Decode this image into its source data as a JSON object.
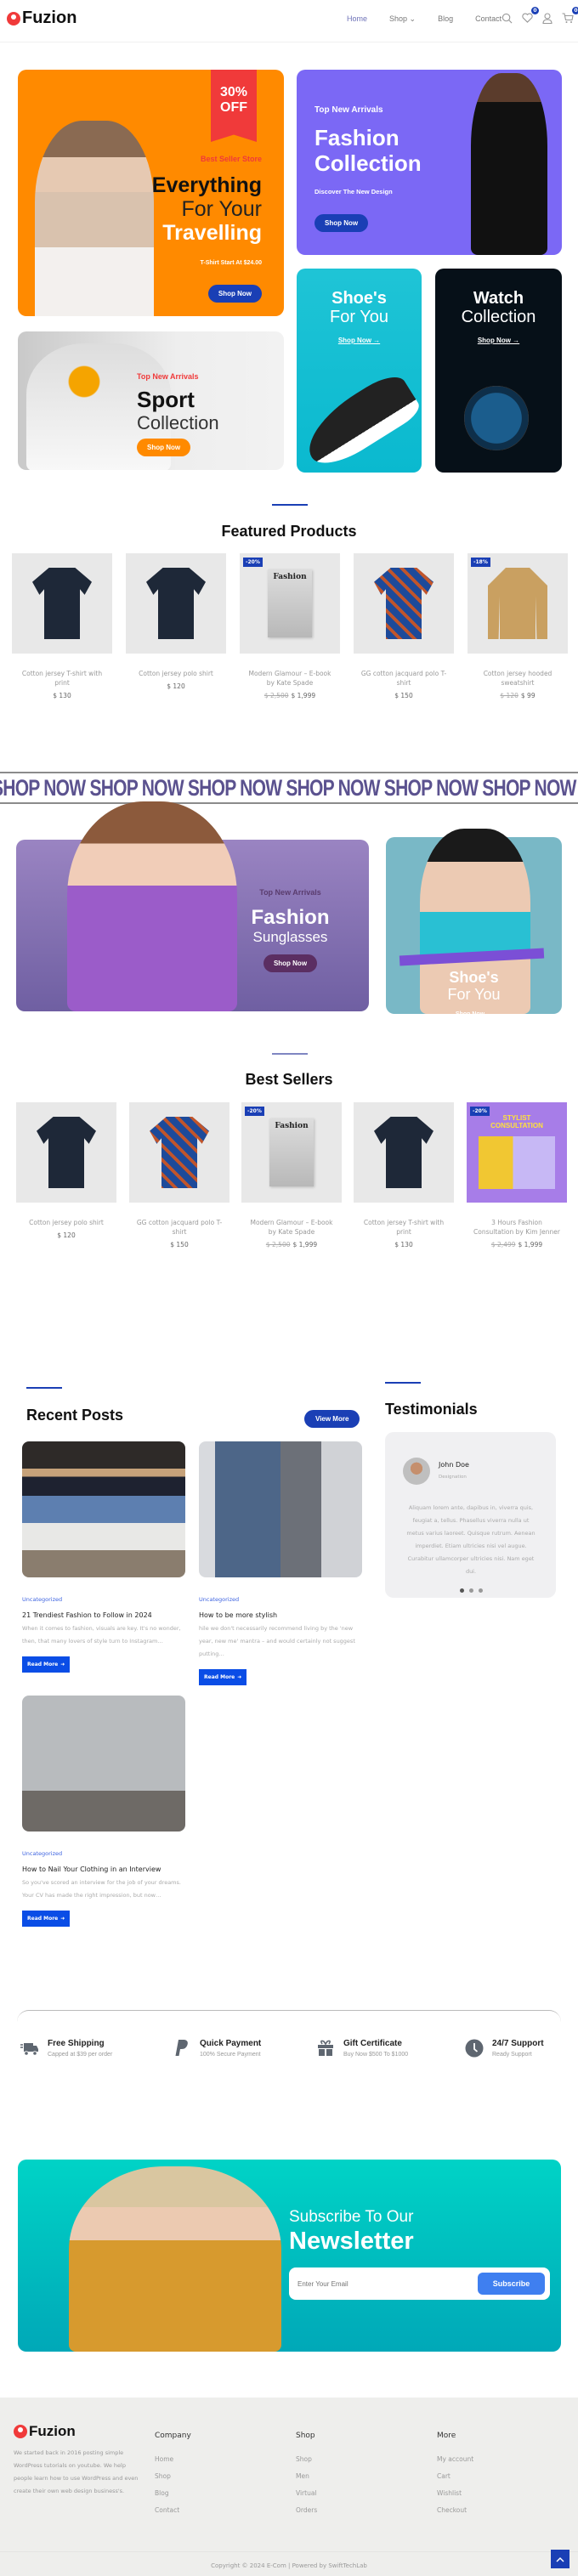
{
  "header": {
    "brand": "Fuzion",
    "nav": [
      {
        "label": "Home",
        "active": true
      },
      {
        "label": "Shop ⌄",
        "active": false
      },
      {
        "label": "Blog",
        "active": false
      },
      {
        "label": "Contact",
        "active": false
      }
    ],
    "icons": [
      "search-icon",
      "heart-icon",
      "user-icon",
      "cart-icon"
    ],
    "wishlist_count": "0",
    "cart_count": "0"
  },
  "hero": {
    "travel": {
      "ribbon": "30%\nOFF",
      "ribbon_line1": "30%",
      "ribbon_line2": "OFF",
      "eyebrow": "Best Seller Store",
      "line1": "Everything",
      "line2": "For Your",
      "line3": "Travelling",
      "sub": "T-Shirt Start At $24.00",
      "cta": "Shop Now"
    },
    "fashion": {
      "eyebrow": "Top New Arrivals",
      "line1": "Fashion",
      "line2": "Collection",
      "sub": "Discover The New Design",
      "cta": "Shop Now"
    },
    "sport": {
      "eyebrow": "Top New Arrivals",
      "line1": "Sport",
      "line2": "Collection",
      "cta": "Shop Now"
    },
    "shoes": {
      "line1": "Shoe's",
      "line2": "For You",
      "cta": "Shop Now →"
    },
    "watch": {
      "line1": "Watch",
      "line2": "Collection",
      "cta": "Shop Now →"
    }
  },
  "featured": {
    "title": "Featured Products",
    "products": [
      {
        "name": "Cotton jersey T-shirt with print",
        "price": "$ 130",
        "old_price": "",
        "badge": "",
        "kind": "tee"
      },
      {
        "name": "Cotton jersey polo shirt",
        "price": "$ 120",
        "old_price": "",
        "badge": "",
        "kind": "shirt"
      },
      {
        "name": "Modern Glamour – E-book by Kate Spade",
        "price": "$ 1,999",
        "old_price": "$ 2,500",
        "badge": "-20%",
        "kind": "book"
      },
      {
        "name": "GG cotton jacquard polo T-shirt",
        "price": "$ 150",
        "old_price": "",
        "badge": "",
        "kind": "polo"
      },
      {
        "name": "Cotton jersey hooded sweatshirt",
        "price": "$ 99",
        "old_price": "$ 120",
        "badge": "-18%",
        "kind": "sweat"
      }
    ]
  },
  "marquee": {
    "text": "SHOP NOW SHOP NOW SHOP NOW SHOP NOW SHOP NOW SHOP NOW SHOP NOW SHOP NOW"
  },
  "promo": {
    "sunglasses": {
      "eyebrow": "Top New Arrivals",
      "line1": "Fashion",
      "line2": "Sunglasses",
      "cta": "Shop Now"
    },
    "shoes": {
      "line1": "Shoe's",
      "line2": "For You",
      "cta": "Shop Now →"
    }
  },
  "bestsellers": {
    "title": "Best Sellers",
    "products": [
      {
        "name": "Cotton jersey polo shirt",
        "price": "$ 120",
        "old_price": "",
        "badge": "",
        "kind": "shirt"
      },
      {
        "name": "GG cotton jacquard polo T-shirt",
        "price": "$ 150",
        "old_price": "",
        "badge": "",
        "kind": "polo"
      },
      {
        "name": "Modern Glamour – E-book by Kate Spade",
        "price": "$ 1,999",
        "old_price": "$ 2,500",
        "badge": "-20%",
        "kind": "book"
      },
      {
        "name": "Cotton jersey T-shirt with print",
        "price": "$ 130",
        "old_price": "",
        "badge": "",
        "kind": "tee"
      },
      {
        "name": "3 Hours Fashion Consultation by Kim Jenner",
        "price": "$ 1,999",
        "old_price": "$ 2,499",
        "badge": "-20%",
        "kind": "stylist"
      }
    ],
    "stylist_label_1": "STYLIST",
    "stylist_label_2": "CONSULTATION"
  },
  "posts": {
    "title": "Recent Posts",
    "view_more": "View More",
    "read_more": "Read More",
    "items": [
      {
        "category": "Uncategorized",
        "title": "21 Trendiest Fashion to Follow in 2024",
        "excerpt": "When it comes to fashion, visuals are key. It's no wonder, then, that many lovers of style turn to Instagram…"
      },
      {
        "category": "Uncategorized",
        "title": "How to be more stylish",
        "excerpt": "hile we don't necessarily recommend living by the 'new year, new me' mantra – and would certainly not suggest putting…"
      },
      {
        "category": "Uncategorized",
        "title": "How to Nail Your Clothing in an Interview",
        "excerpt": "So you've scored an interview for the job of your dreams. Your CV has made the right impression, but now…"
      }
    ]
  },
  "testimonials": {
    "title": "Testimonials",
    "name": "John Doe",
    "designation": "Designation",
    "quote": "Aliquam lorem ante, dapibus in, viverra quis, feugiat a, tellus. Phasellus viverra nulla ut metus varius laoreet. Quisque rutrum. Aenean imperdiet. Etiam ultricies nisi vel augue. Curabitur ullamcorper ultricies nisi. Nam eget dui.",
    "dots": 3,
    "active_dot": 1
  },
  "features": [
    {
      "icon": "truck-icon",
      "title": "Free Shipping",
      "sub": "Capped at $39 per order"
    },
    {
      "icon": "paypal-icon",
      "title": "Quick Payment",
      "sub": "100% Secure Payment"
    },
    {
      "icon": "gift-icon",
      "title": "Gift Certificate",
      "sub": "Buy Now $500 To $1000"
    },
    {
      "icon": "clock-icon",
      "title": "24/7 Support",
      "sub": "Ready Support"
    }
  ],
  "newsletter": {
    "line1": "Subscribe To Our",
    "line2": "Newsletter",
    "placeholder": "Enter Your Email",
    "button": "Subscribe"
  },
  "footer": {
    "brand": "Fuzion",
    "about": "We started back in 2016 posting simple WordPress tutorials on youtube. We help people learn how to use WordPress and even create their own web design business's.",
    "columns": [
      {
        "title": "Company",
        "links": [
          "Home",
          "Shop",
          "Blog",
          "Contact"
        ]
      },
      {
        "title": "Shop",
        "links": [
          "Shop",
          "Men",
          "Virtual",
          "Orders"
        ]
      },
      {
        "title": "More",
        "links": [
          "My account",
          "Cart",
          "Wishlist",
          "Checkout"
        ]
      }
    ],
    "copyright": "Copyright © 2024 E-Com | Powered by SwiftTechLab"
  },
  "colors": {
    "brand_red": "#f03a3a",
    "accent_blue": "#1a3fb5",
    "orange": "#ff8a00",
    "purple": "#7b68f5",
    "teal": "#1fc4d6"
  }
}
